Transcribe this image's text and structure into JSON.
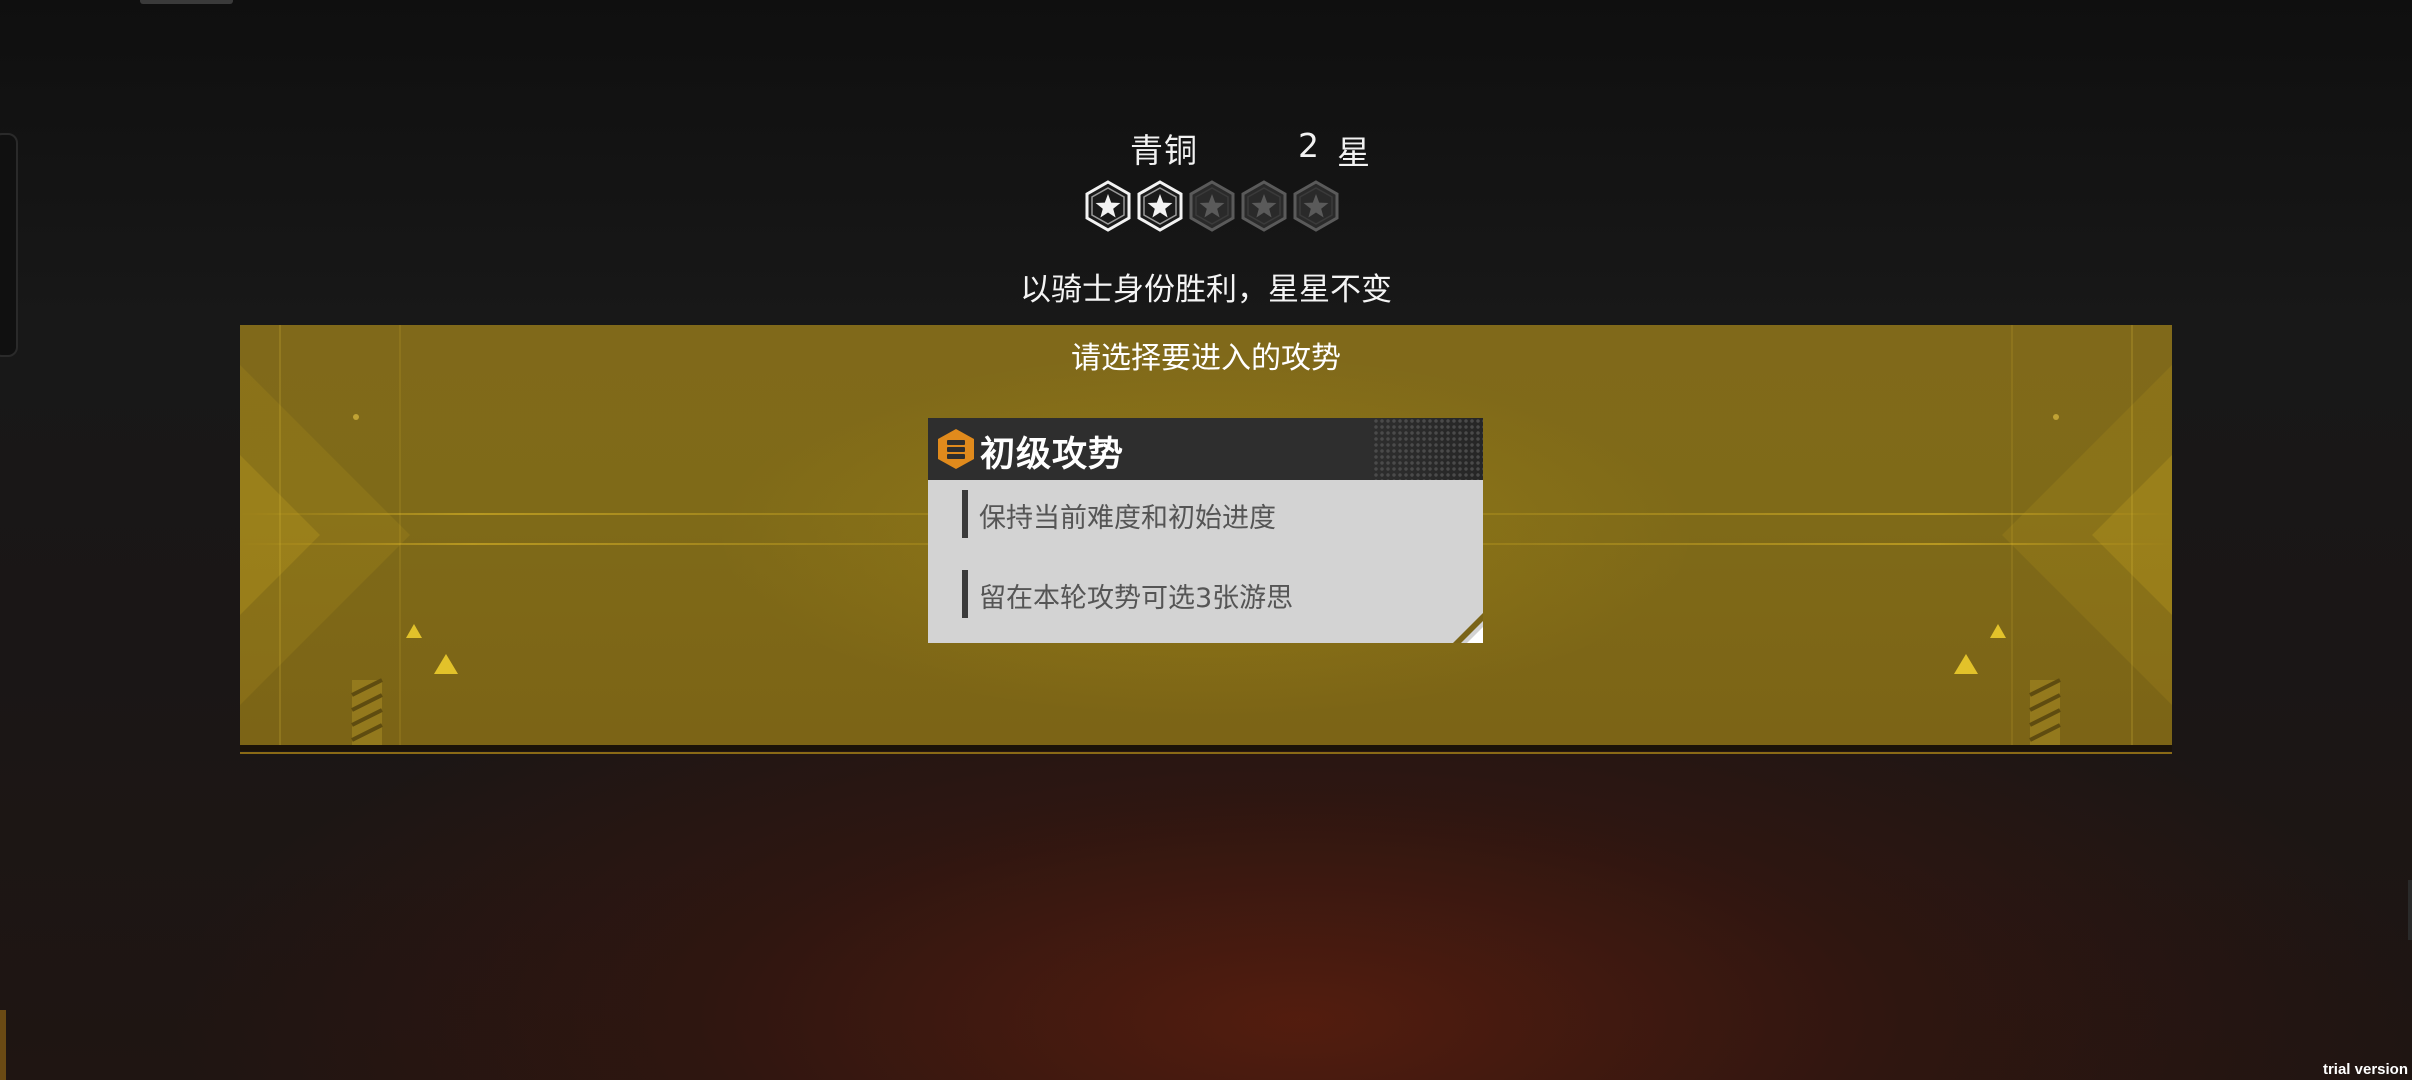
{
  "rank": {
    "tier": "青铜",
    "star_count": "2",
    "star_word": "星",
    "stars_filled": 2,
    "stars_total": 5
  },
  "rule_text": "以骑士身份胜利，星星不变",
  "prompt": "请选择要进入的攻势",
  "option": {
    "badge_icon": "hexagon-stack-icon",
    "title": "初级攻势",
    "lines": [
      "保持当前难度和初始进度",
      "留在本轮攻势可选3张游思"
    ]
  },
  "colors": {
    "band_gold": "#7f6a18",
    "badge_orange": "#e08a1c",
    "star_active": "#f2f2f2",
    "star_inactive": "#5a5a5a"
  },
  "watermark": "trial version"
}
